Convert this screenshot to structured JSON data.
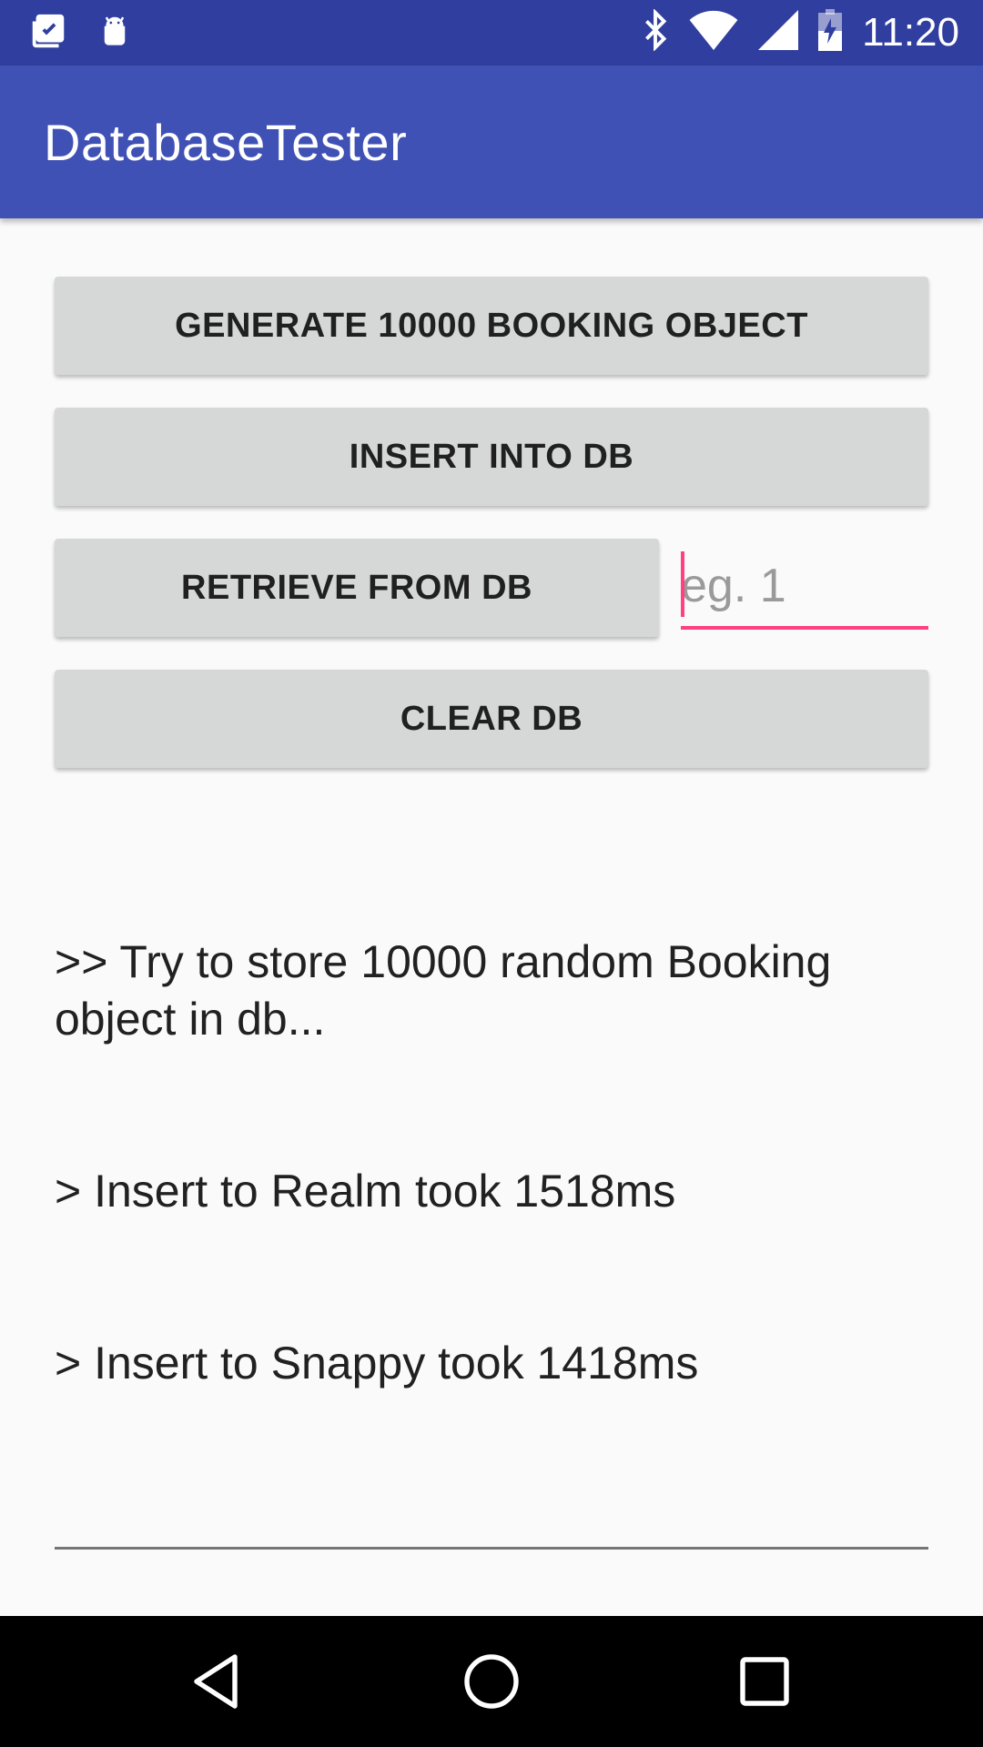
{
  "status_bar": {
    "time": "11:20",
    "icons": [
      "clipboard-check-icon",
      "android-icon",
      "bluetooth-icon",
      "wifi-icon",
      "signal-icon",
      "battery-charging-icon"
    ]
  },
  "app_bar": {
    "title": "DatabaseTester"
  },
  "buttons": {
    "generate": "GENERATE 10000 BOOKING OBJECT",
    "insert": "INSERT INTO DB",
    "retrieve": "RETRIEVE FROM DB",
    "clear": "CLEAR DB"
  },
  "id_input": {
    "placeholder": "eg. 1",
    "value": "",
    "accent_color": "#ff4081"
  },
  "log": {
    "lines": [
      ">> Try to store 10000 random Booking object in db...",
      "> Insert to Realm took 1518ms",
      "> Insert to Snappy took 1418ms"
    ]
  },
  "colors": {
    "primary": "#3f51b5",
    "primary_dark": "#303f9f",
    "accent": "#ff4081",
    "button": "#d6d7d7"
  },
  "nav_bar": {
    "icons": [
      "back-icon",
      "home-icon",
      "recents-icon"
    ]
  }
}
